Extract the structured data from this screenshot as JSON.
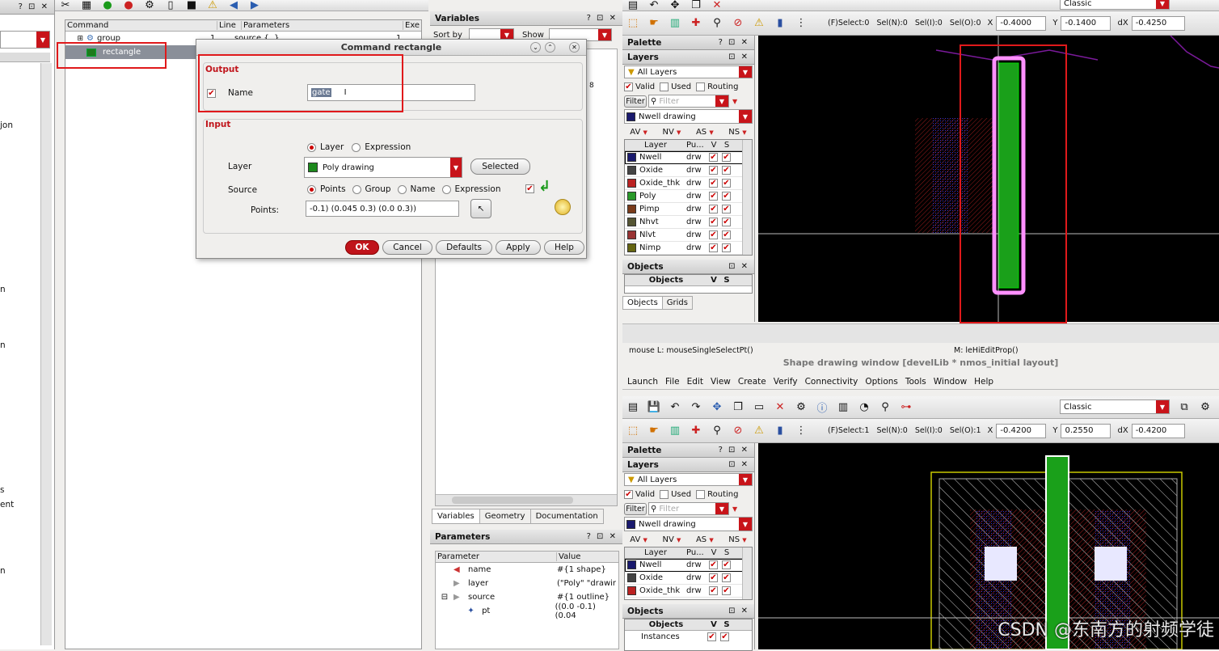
{
  "left": {
    "frag1": "jon",
    "frag2": "n",
    "frag3": "n",
    "frag4": "s",
    "frag5": "ent",
    "frag6": "n"
  },
  "command_panel": {
    "columns": [
      "Command",
      "Line",
      "Parameters",
      "Exe"
    ],
    "rows": [
      {
        "name": "group",
        "line": "1",
        "params": "source {..}",
        "exe": "1"
      },
      {
        "name": "rectangle",
        "line": "",
        "params": "",
        "exe": ""
      }
    ]
  },
  "dialog": {
    "title": "Command rectangle",
    "output_label": "Output",
    "name_label": "Name",
    "name_value": "gate",
    "input_label": "Input",
    "layer_radio": "Layer",
    "expression_radio": "Expression",
    "layer_label": "Layer",
    "layer_value": "Poly drawing",
    "selected_btn": "Selected",
    "source_label": "Source",
    "source_opts": [
      "Points",
      "Group",
      "Name",
      "Expression"
    ],
    "points_label": "Points:",
    "points_value": "-0.1) (0.045 0.3) (0.0 0.3))",
    "buttons": {
      "ok": "OK",
      "cancel": "Cancel",
      "defaults": "Defaults",
      "apply": "Apply",
      "help": "Help"
    }
  },
  "variables": {
    "title": "Variables",
    "sortby": "Sort by",
    "show": "Show",
    "tabs": [
      "Variables",
      "Geometry",
      "Documentation"
    ],
    "frag": "8"
  },
  "parameters": {
    "title": "Parameters",
    "cols": [
      "Parameter",
      "Value"
    ],
    "rows": [
      {
        "name": "name",
        "value": "#{1 shape}"
      },
      {
        "name": "layer",
        "value": "(\"Poly\" \"drawir"
      },
      {
        "name": "source",
        "value": "#{1 outline}"
      },
      {
        "name": "pt",
        "value": "((0.0 -0.1) (0.04"
      }
    ]
  },
  "top_window": {
    "classic": "Classic",
    "sel": "(F)Select:0   Sel(N):0   Sel(I):0   Sel(O):0",
    "x": "-0.4000",
    "y": "-0.1400",
    "dx": "-0.4250",
    "palette": "Palette",
    "layers": "Layers",
    "all_layers": "All Layers",
    "valid": "Valid",
    "used": "Used",
    "routing": "Routing",
    "filter": "Filter",
    "filter_ph": "Filter",
    "lpp": "Nwell drawing",
    "vis": [
      "AV",
      "NV",
      "AS",
      "NS"
    ],
    "cols": [
      "Layer",
      "Pu...",
      "V",
      "S"
    ],
    "layer_rows": [
      {
        "name": "Nwell",
        "p": "drw",
        "color": "#1a1a6e"
      },
      {
        "name": "Oxide",
        "p": "drw",
        "color": "#444"
      },
      {
        "name": "Oxide_thk",
        "p": "drw",
        "color": "#b22"
      },
      {
        "name": "Poly",
        "p": "drw",
        "color": "#2a9a2a"
      },
      {
        "name": "Pimp",
        "p": "drw",
        "color": "#7a3b1a"
      },
      {
        "name": "Nhvt",
        "p": "drw",
        "color": "#553"
      },
      {
        "name": "Nlvt",
        "p": "drw",
        "color": "#933"
      },
      {
        "name": "Nimp",
        "p": "drw",
        "color": "#666612"
      }
    ],
    "objects": "Objects",
    "objects_col": "Objects",
    "tabs": [
      "Objects",
      "Grids"
    ]
  },
  "status": {
    "mouse": "mouse L: mouseSingleSelectPt()",
    "m": "M: leHiEditProp()",
    "window_title": "Shape drawing window [develLib * nmos_initial layout]"
  },
  "bottom_window": {
    "menu": [
      "Launch",
      "File",
      "Edit",
      "View",
      "Create",
      "Verify",
      "Connectivity",
      "Options",
      "Tools",
      "Window",
      "Help"
    ],
    "classic": "Classic",
    "sel": "(F)Select:1   Sel(N):0   Sel(I):0   Sel(O):1",
    "x": "-0.4200",
    "y": "0.2550",
    "dx": "-0.4200",
    "lpp": "Nwell drawing",
    "layer_rows": [
      {
        "name": "Nwell",
        "p": "drw",
        "color": "#1a1a6e"
      },
      {
        "name": "Oxide",
        "p": "drw",
        "color": "#444"
      },
      {
        "name": "Oxide_thk",
        "p": "drw",
        "color": "#b22"
      }
    ],
    "instances": "Instances"
  },
  "watermark": "CSDN @东南方的射频学徒"
}
